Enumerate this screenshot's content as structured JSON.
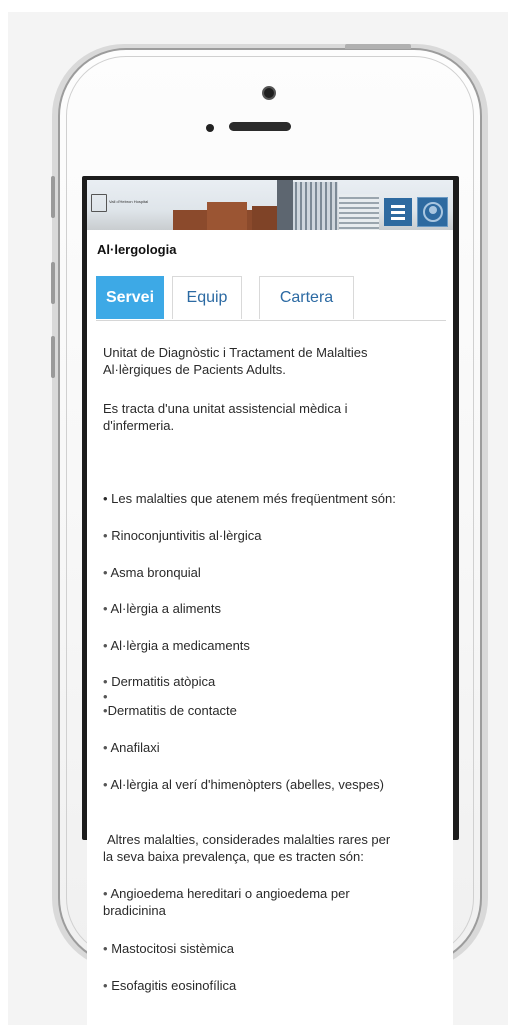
{
  "header": {
    "logo_text": "Vall d'Hebron Hospital",
    "accent_color": "#2e6aa0",
    "menu_icon": "hamburger-icon",
    "user_icon": "user-icon"
  },
  "page": {
    "title": "Al·lergologia"
  },
  "tabs": [
    {
      "label": "Servei",
      "active": true
    },
    {
      "label": "Equip",
      "active": false
    },
    {
      "label": "Cartera",
      "active": false
    }
  ],
  "content": {
    "intro_line1": "Unitat de Diagnòstic i Tractament de Malalties",
    "intro_line2": "Al·lèrgiques de Pacients Adults.",
    "desc_line1": "Es tracta d'una unitat assistencial mèdica i",
    "desc_line2": "d'infermeria.",
    "common_heading": "• Les malalties que atenem més freqüentment són:",
    "common_list": [
      "Rinoconjuntivitis al·lèrgica",
      "Asma bronquial",
      "Al·lèrgia a aliments",
      "Al·lèrgia a medicaments",
      "Dermatitis atòpica",
      "Dermatitis de contacte",
      "Anafilaxi",
      "Al·lèrgia al verí d'himenòpters (abelles, vespes)"
    ],
    "rare_line1": "Altres malalties, considerades malalties rares per",
    "rare_line2": "la seva baixa prevalença, que es tracten són:",
    "rare_list": [
      {
        "line1": "Angioedema hereditari o angioedema per",
        "line2": "bradicinina"
      },
      {
        "line1": "Mastocitosi sistèmica",
        "line2": ""
      },
      {
        "line1": "Esofagitis eosinofílica",
        "line2": ""
      }
    ],
    "bullet": "•"
  }
}
